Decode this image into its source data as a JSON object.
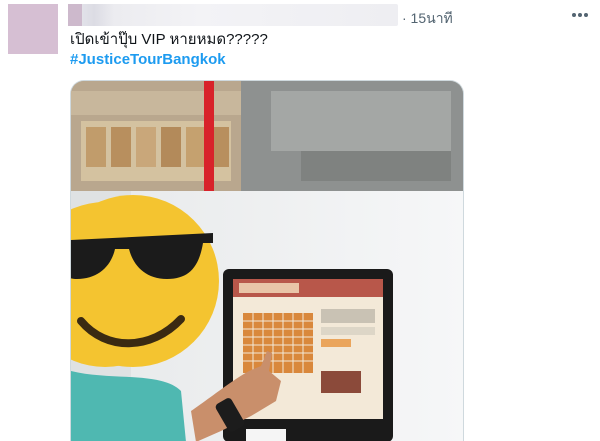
{
  "tweet": {
    "time": "· 15นาที",
    "text": "เปิดเข้าปุ๊บ VIP หายหมด?????",
    "hashtag": "#JusticeTourBangkok"
  },
  "icons": {
    "more": "more-options-icon",
    "emoji": "sunglasses-face-emoji"
  },
  "colors": {
    "hashtag": "#1d9bf0",
    "meta_text": "#536471",
    "body_text": "#0f1419",
    "emoji_face": "#f4c430"
  }
}
